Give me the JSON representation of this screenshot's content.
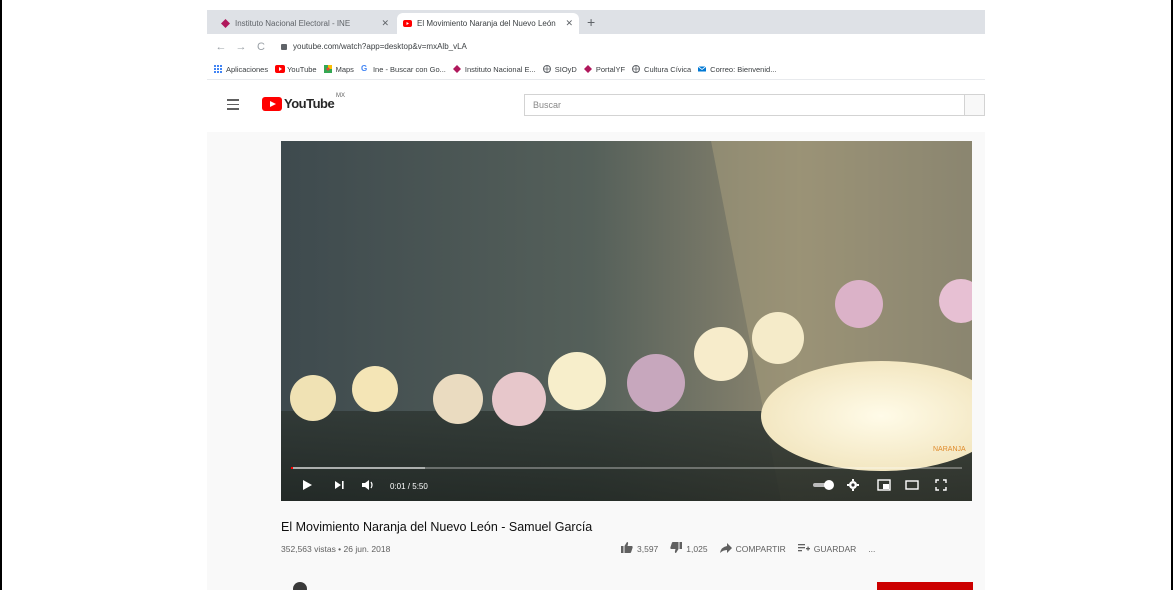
{
  "browser": {
    "tabs": [
      {
        "label": "Instituto Nacional Electoral - INE",
        "close": "✕",
        "favicon_color": "#b0185c"
      },
      {
        "label": "El Movimiento Naranja del Nuevo León",
        "close": "✕",
        "favicon_color": "#ff0000"
      }
    ],
    "new_tab": "+",
    "nav": {
      "back": "←",
      "forward": "→",
      "reload": "C"
    },
    "url": "youtube.com/watch?app=desktop&v=mxAlb_vLA"
  },
  "bookmarks": [
    {
      "label": "Aplicaciones",
      "icon": "apps-icon",
      "color": "#4285f4"
    },
    {
      "label": "YouTube",
      "icon": "youtube-icon",
      "color": "#ff0000"
    },
    {
      "label": "Maps",
      "icon": "maps-icon",
      "color": "#34a853"
    },
    {
      "label": "Ine - Buscar con Go...",
      "icon": "google-icon",
      "color": "#4285f4"
    },
    {
      "label": "Instituto Nacional E...",
      "icon": "ine-icon",
      "color": "#b0185c"
    },
    {
      "label": "SIOyD",
      "icon": "globe-icon",
      "color": "#5f6368"
    },
    {
      "label": "PortalYF",
      "icon": "ine-icon",
      "color": "#b0185c"
    },
    {
      "label": "Cultura Cívica",
      "icon": "globe-icon",
      "color": "#5f6368"
    },
    {
      "label": "Correo: Bienvenid...",
      "icon": "mail-icon",
      "color": "#0078d4"
    }
  ],
  "youtube": {
    "logo_text": "YouTube",
    "logo_country": "MX",
    "search_placeholder": "Buscar"
  },
  "player": {
    "time": "0:01 / 5:50",
    "progress": 0.003,
    "buffered": 0.2,
    "watermark": "NARANJA"
  },
  "video": {
    "title": "El Movimiento Naranja del Nuevo León - Samuel García",
    "views_date": "352,563 vistas • 26 jun. 2018",
    "likes": "3,597",
    "dislikes": "1,025",
    "share_label": "COMPARTIR",
    "save_label": "GUARDAR",
    "more": "..."
  }
}
